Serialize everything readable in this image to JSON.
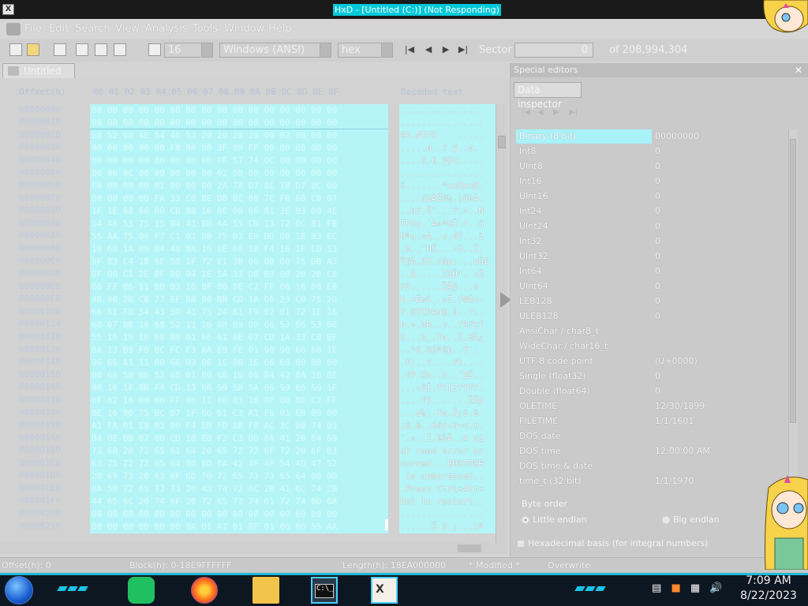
{
  "window": {
    "title": "HxD - [Untitled (C:)] (Not Responding)",
    "app_icon": "X"
  },
  "menu": [
    "File",
    "Edit",
    "Search",
    "View",
    "Analysis",
    "Tools",
    "Window",
    "Help"
  ],
  "toolbar": {
    "bytes_per_row": "16",
    "charset": "Windows (ANSI)",
    "base": "hex",
    "sector_label": "Sector",
    "sector_value": "0",
    "of_label": "of 208,994,304"
  },
  "doc_tab": {
    "label": "Untitled (C:)"
  },
  "hex": {
    "rows": [
      "00 00 00 00 00 00 00 00 00 00 00 00 00 00 00 00",
      "00 00 00 00 00 00 00 00 00 00 00 00 00 00 00 00",
      "EB 52 90 4E 54 46 53 20 20 20 20 00 02 08 00 00",
      "00 00 00 00 00 F8 00 00 3F 00 FF 00 00 08 00 00",
      "00 00 00 00 80 00 80 00 FF 57 74 0C 00 00 00 00",
      "00 00 0C 00 00 00 00 00 02 00 00 00 00 00 00 00",
      "F6 00 00 00 01 00 00 00 2A 78 D7 8C 78 D7 8C 00",
      "00 00 00 00 FA 33 C0 8E D0 BC 00 7C FB 68 C0 07",
      "1F 1E 68 66 00 CB 88 16 0E 00 66 81 3E 03 00 4E",
      "54 46 53 75 15 B4 41 BB AA 55 CD 13 72 0C 81 FB",
      "55 AA 75 06 F7 C1 01 00 75 03 E9 DD 00 1E 83 EC",
      "18 68 1A 00 B4 48 8A 16 0E 00 8B F4 16 1F CD 13",
      "9F 83 C4 18 9E 58 1F 72 E1 3B 06 0B 00 75 DB A3",
      "0F 00 C1 2E 0F 00 04 1E 5A 33 DB B9 00 20 2B C8",
      "66 FF 06 11 00 03 16 0F 00 8E C2 FF 06 16 00 E8",
      "4B 00 2B C8 77 EF B8 00 BB CD 1A 66 23 C0 75 2D",
      "66 81 FB 54 43 50 41 75 24 81 F9 02 01 72 1E 16",
      "68 07 BB 16 68 52 11 16 68 09 00 66 53 66 53 66",
      "55 16 16 16 68 B8 01 66 61 0E 07 CD 1A 33 C0 BF",
      "0A 13 B9 F6 0C FC F3 AA E9 FE 01 90 90 66 60 1E",
      "06 66 A1 11 00 66 03 06 1C 00 1E 66 68 00 00 00",
      "00 66 50 06 53 68 01 00 68 10 00 B4 42 8A 16 0E",
      "00 16 1F 8B F4 CD 13 66 59 5B 5A 66 59 66 59 1F",
      "0F 82 16 00 66 FF 06 11 00 03 16 0F 00 8E C2 FF",
      "0E 16 00 75 BC 07 1F 66 61 C3 A1 F6 01 E8 09 00",
      "A1 FA 01 E8 03 00 F4 EB FD 8B F0 AC 3C 00 74 09",
      "B4 0E BB 07 00 CD 10 EB F2 C3 0D 0A 41 20 64 69",
      "73 6B 20 72 65 61 64 20 65 72 72 6F 72 20 6F 63",
      "63 75 72 72 65 64 00 0D 0A 42 4F 4F 54 4D 47 52",
      "20 69 73 20 63 6F 6D 70 72 65 73 73 65 64 00 0D",
      "0A 50 72 65 73 73 20 43 74 72 6C 2B 41 6C 74 2B",
      "44 65 6C 20 74 6F 20 72 65 73 74 61 72 74 0D 0A",
      "00 00 00 00 00 00 00 00 00 00 00 00 00 00 00 00",
      "00 00 00 00 00 00 8A 01 A7 01 BF 01 00 00 55 AA"
    ],
    "text_rows": [
      "................",
      "................",
      "ëR.NTFS    .....",
      ".....ø..?.ÿ..ø.",
      "....€.€.ÿÿt.....",
      "................",
      "ö.......*x×Œx×Œ.",
      "....ú3ÀŽÐ¼.|ûhÀ.",
      "..hf.Ëˆ...f.>..N",
      "TFSu.´A»ªUÍ.r..û",
      "Uªu.÷Á..u.éÝ...ì",
      ".h..´HŠ...‹ô..Í.",
      "ŸƒÄ.žX.ráp;...uÛ£",
      "..Á.....Z3Û¹. +È",
      "fÿ......ŽÂÿ...è",
      "K.+Èwï¸.»Í.f#Àu-",
      "f.ûTCPAu$.ù..r..",
      "h.».hR..h..fSfSf",
      "U...h¸.fa..Í.3À¿",
      "..¹ö.üóªéþ..f`.",
      ".f¡..f....fh....",
      ".fP.Sh..h..´BŠ..",
      "...‹ôÍ.fY[ZfYfY.",
      ".‚..fÿ.......ŽÂÿ",
      "...u¼..fa.Ã¡ö.è.",
      "¡ú.è..ôëý‹ð¬<.t.",
      "´.»..Í.ëòÃ..A di",
      "sk read error oc",
      "curred...BOOTMGR",
      " is compressed..",
      ".Press Ctrl+Alt+",
      "Del to restart..",
      "................",
      "......Š.§.¿...Uª"
    ]
  },
  "special_editors": {
    "header": "Special editors",
    "tab": "Data inspector",
    "rows": [
      {
        "name": "Binary (8 bit)",
        "link": "",
        "value": "00000000",
        "selected": true
      },
      {
        "name": "Int8",
        "link": "",
        "value": "0"
      },
      {
        "name": "UInt8",
        "link": "",
        "value": "0"
      },
      {
        "name": "Int16",
        "link": "",
        "value": "0"
      },
      {
        "name": "UInt16",
        "link": "",
        "value": "0"
      },
      {
        "name": "Int24",
        "link": "",
        "value": "0"
      },
      {
        "name": "UInt24",
        "link": "",
        "value": "0"
      },
      {
        "name": "Int32",
        "link": "",
        "value": "0"
      },
      {
        "name": "UInt32",
        "link": "",
        "value": "0"
      },
      {
        "name": "Int64",
        "link": "",
        "value": "0"
      },
      {
        "name": "UInt64",
        "link": "",
        "value": "0"
      },
      {
        "name": "LEB128",
        "link": "",
        "value": "0"
      },
      {
        "name": "ULEB128",
        "link": "",
        "value": "0"
      },
      {
        "name": "AnsiChar / char8_t",
        "link": "",
        "value": ""
      },
      {
        "name": "WideChar / char16_t",
        "link": "",
        "value": ""
      },
      {
        "name": "UTF-8 code point",
        "link": "",
        "value": "   (U+0000)"
      },
      {
        "name": "Single (float32)",
        "link": "",
        "value": "0"
      },
      {
        "name": "Double (float64)",
        "link": "",
        "value": "0"
      },
      {
        "name": "OLETIME",
        "link": "",
        "value": "12/30/1899"
      },
      {
        "name": "FILETIME",
        "link": "",
        "value": "1/1/1601"
      },
      {
        "name": "DOS date",
        "link": "",
        "value": ""
      },
      {
        "name": "DOS time",
        "link": "",
        "value": "12:00:00 AM"
      },
      {
        "name": "DOS time & date",
        "link": "",
        "value": ""
      },
      {
        "name": "time_t (32 bit)",
        "link": "",
        "value": "1/1/1970"
      }
    ],
    "byte_order_label": "Byte order",
    "little_endian": "Little endian",
    "big_endian": "Big endian",
    "hex_basis": "Hexadecimal basis (for integral numbers)"
  },
  "status": {
    "offset": "Offset(h): 0",
    "block": "Block(h): 0-18E9FFFFFF",
    "length": "Length(h): 18EA000000",
    "modified": "* Modified *",
    "mode": "Overwrite"
  },
  "taskbar": {
    "time": "7:09 AM",
    "date": "8/22/2023"
  },
  "colors": {
    "selection": "#b6f5f7",
    "accent": "#00c8d8",
    "taskbar": "#0d1722"
  }
}
